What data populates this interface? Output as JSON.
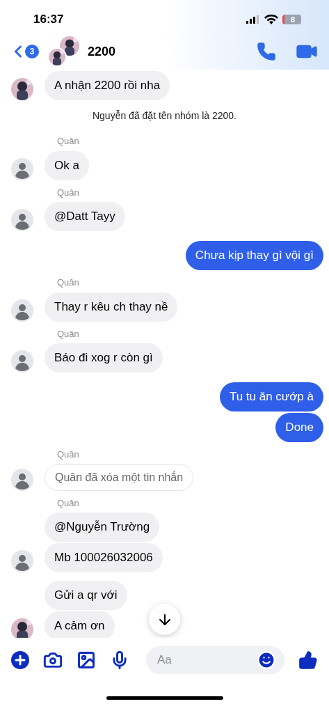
{
  "status_bar": {
    "time": "16:37",
    "battery": "8"
  },
  "header": {
    "back_count": "3",
    "title": "2200"
  },
  "messages": [
    {
      "kind": "incoming",
      "text": "A nhận 2200 rồi nha"
    },
    {
      "kind": "system",
      "text": "Nguyễn đã đặt tên nhóm là 2200."
    },
    {
      "kind": "incoming",
      "sender": "Quân",
      "text": "Ok a",
      "avatar": {
        "kind": "default"
      }
    },
    {
      "kind": "incoming",
      "sender": "Quân",
      "text": "@Datt Tayy",
      "avatar": {
        "kind": "default"
      }
    },
    {
      "kind": "outgoing",
      "text": "Chưa kịp thay gì vội gì"
    },
    {
      "kind": "incoming",
      "sender": "Quân",
      "text": "Thay r kêu ch thay nề",
      "avatar": {
        "kind": "default"
      }
    },
    {
      "kind": "incoming",
      "sender": "Quân",
      "text": "Báo đi xog r còn gì",
      "avatar": {
        "kind": "default"
      }
    },
    {
      "kind": "outgoing",
      "text": "Tu tu ăn cướp à"
    },
    {
      "kind": "outgoing",
      "text": "Done"
    },
    {
      "kind": "deleted",
      "sender": "Quân",
      "text": "Quân đã xóa một tin nhắn",
      "avatar": {
        "kind": "default"
      }
    },
    {
      "kind": "incoming",
      "sender": "Quân",
      "text": "@Nguyễn Trường"
    },
    {
      "kind": "incoming",
      "text": "Mb 100026032006",
      "avatar": {
        "kind": "default"
      }
    },
    {
      "kind": "incoming",
      "text": "Gửi a qr với"
    },
    {
      "kind": "incoming",
      "text": "A cảm ơn"
    }
  ],
  "composer": {
    "placeholder": "Aa"
  }
}
